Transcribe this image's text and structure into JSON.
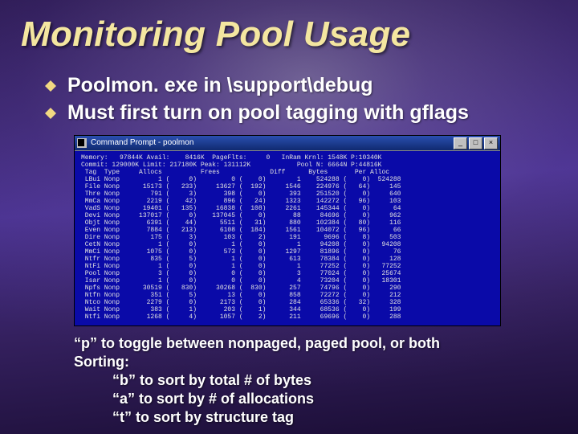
{
  "slide": {
    "title": "Monitoring Pool Usage",
    "bullets": [
      "Poolmon. exe in \\support\\debug",
      "Must first turn on pool tagging with gflags"
    ],
    "notes": {
      "line1": "“p” to toggle between nonpaged, paged pool, or both",
      "line2": "Sorting:",
      "line3": "“b” to sort by total # of bytes",
      "line4": "“a” to sort by # of allocations",
      "line5": "“t” to sort by structure tag"
    }
  },
  "cmd": {
    "title": "Command Prompt - poolmon",
    "min": "_",
    "max": "□",
    "close": "×",
    "header1": "Memory:   97844K Avail:    8416K  PageFlts:     0   InRam Krnl: 1548K P:10340K",
    "header2": "Commit: 129000K Limit: 217180K Peak: 131112K            Pool N: 6664N P:44816K",
    "colhdr": " Tag  Type     Allocs          Frees             Diff      Bytes       Per Alloc",
    "rows": [
      " LBui Nonp          1 (     0)         0 (    0)        1    524288 (    0)  524288",
      " File Nonp      15173 (   233)     13627 (  192)     1546    224976 (   64)     145",
      " Thre Nonp        791 (     3)       398 (    0)      393    251520 (    0)     640",
      " MmCa Nonp       2219 (    42)       896 (   24)     1323    142272 (   96)     103",
      " VadS Nonp      19401 (   135)     16838 (  108)     2261    145344 (    0)      64",
      " Devi Nonp     137017 (     0)    137045 (    0)       88     84696 (    0)     962",
      " Objt Nonp       6391 (    44)      5511 (   31)      880    102384 (   80)     116",
      " Even Nonp       7884 (   213)      6108 (  184)     1561    104072 (   96)      66",
      " Dire Nonp        175 (     3)       103 (    2)      191      9696 (    8)     503",
      " CetN Nonp          1 (     0)         1 (    0)        1     94208 (    0)   94208",
      " MmCi Nonp       1075 (     0)       573 (    0)     1297     81896 (    0)      76",
      " Ntfr Nonp        835 (     5)         1 (    0)      613     78384 (    0)     128",
      " NtFi Nonp          1 (     0)         1 (    0)        1     77252 (    0)   77252",
      " Pool Nonp          3 (     0)         0 (    0)        3     77024 (    0)   25674",
      " Isar Nonp          1 (     0)         0 (    0)        4     73204 (    0)   18301",
      " Npfs Nonp      30519 (   830)     30268 (  830)      257     74796 (    0)     290",
      " Ntfn Nonp        351 (     5)        13 (    0)      858     72272 (    0)     212",
      " Ntco Nonp       2279 (     0)      2173 (    0)      284     65336 (   32)     328",
      " Wait Nonp        383 (     1)       203 (    1)      344     68536 (    0)     199",
      " Ntfi Nonp       1268 (     4)      1057 (    2)      211     69696 (    0)     288"
    ]
  }
}
